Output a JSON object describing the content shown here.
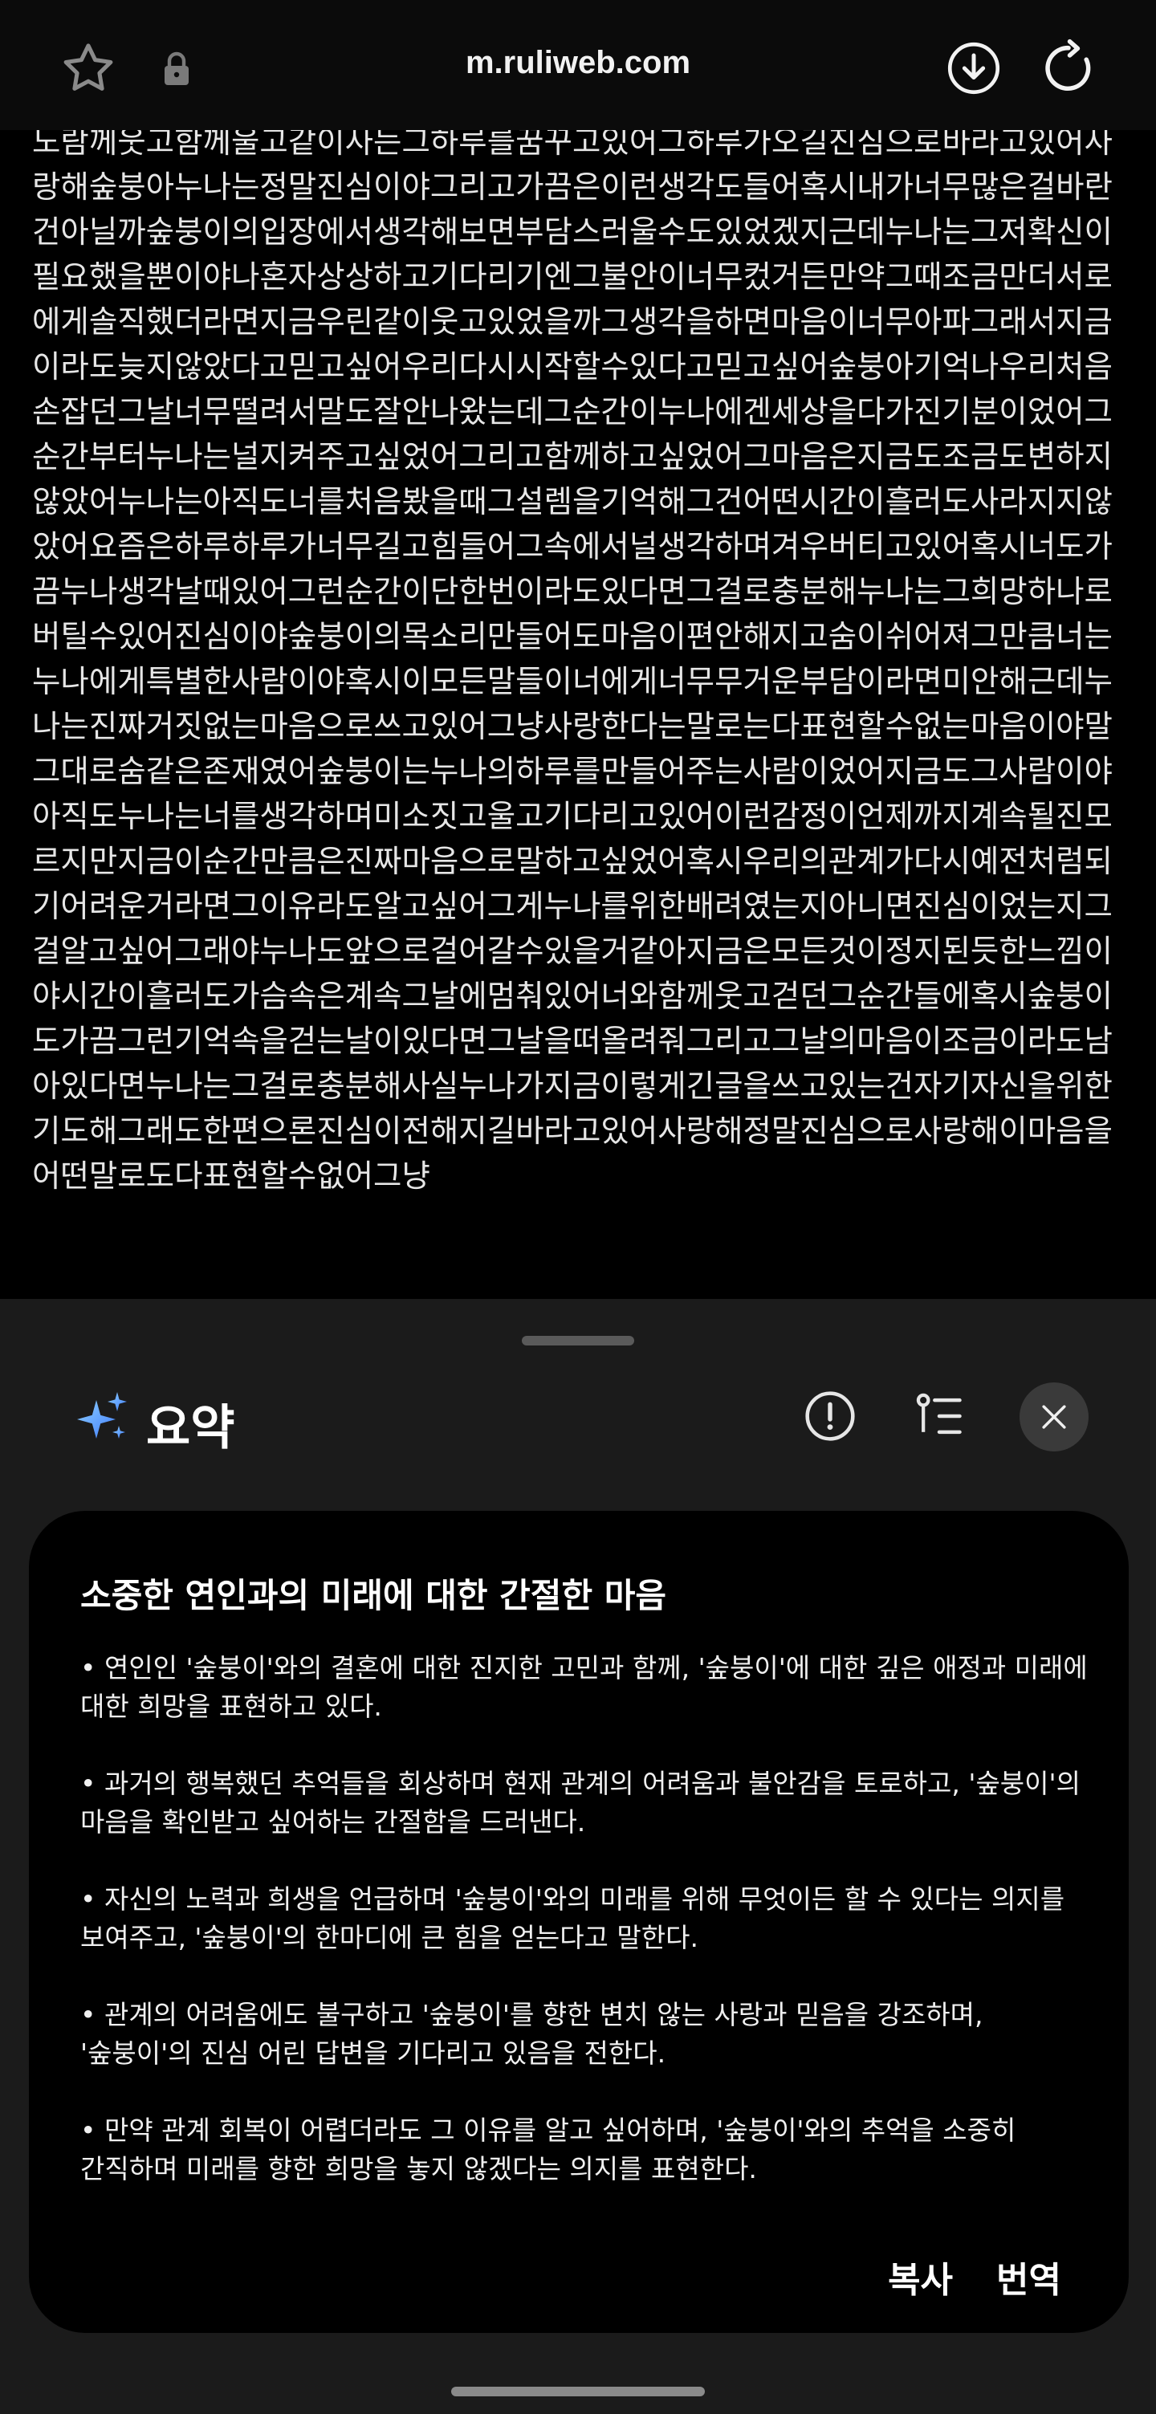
{
  "browser": {
    "url": "m.ruliweb.com",
    "icons": {
      "favorite": "star-outline-icon",
      "security": "lock-icon",
      "download": "download-circle-icon",
      "reload": "reload-icon"
    }
  },
  "article": {
    "text": "노람께웃고함께울고같이사는그하루를꿈꾸고있어그하루가오길진심으로바라고있어사랑해숲붕아누나는정말진심이야그리고가끔은이런생각도들어혹시내가너무많은걸바란건아닐까숲붕이의입장에서생각해보면부담스러울수도있었겠지근데누나는그저확신이필요했을뿐이야나혼자상상하고기다리기엔그불안이너무컸거든만약그때조금만더서로에게솔직했더라면지금우린같이웃고있었을까그생각을하면마음이너무아파그래서지금이라도늦지않았다고믿고싶어우리다시시작할수있다고믿고싶어숲붕아기억나우리처음손잡던그날너무떨려서말도잘안나왔는데그순간이누나에겐세상을다가진기분이었어그순간부터누나는널지켜주고싶었어그리고함께하고싶었어그마음은지금도조금도변하지않았어누나는아직도너를처음봤을때그설렘을기억해그건어떤시간이흘러도사라지지않았어요즘은하루하루가너무길고힘들어그속에서널생각하며겨우버티고있어혹시너도가끔누나생각날때있어그런순간이단한번이라도있다면그걸로충분해누나는그희망하나로버틸수있어진심이야숲붕이의목소리만들어도마음이편안해지고숨이쉬어져그만큼너는누나에게특별한사람이야혹시이모든말들이너에게너무무거운부담이라면미안해근데누나는진짜거짓없는마음으로쓰고있어그냥사랑한다는말로는다표현할수없는마음이야말그대로숨같은존재였어숲붕이는누나의하루를만들어주는사람이었어지금도그사람이야아직도누나는너를생각하며미소짓고울고기다리고있어이런감정이언제까지계속될진모르지만지금이순간만큼은진짜마음으로말하고싶었어혹시우리의관계가다시예전처럼되기어려운거라면그이유라도알고싶어그게누나를위한배려였는지아니면진심이었는지그걸알고싶어그래야누나도앞으로걸어갈수있을거같아지금은모든것이정지된듯한느낌이야시간이흘러도가슴속은계속그날에멈춰있어너와함께웃고걷던그순간들에혹시숲붕이도가끔그런기억속을걷는날이있다면그날을떠올려줘그리고그날의마음이조금이라도남아있다면누나는그걸로충분해사실누나가지금이렇게긴글을쓰고있는건자기자신을위한기도해그래도한편으론진심이전해지길바라고있어사랑해정말진심으로사랑해이마음을어떤말로도다표현할수없어그냥"
  },
  "summary": {
    "title": "요약",
    "icons": {
      "sparkle": "sparkle-icon",
      "info": "info-icon",
      "outline": "outline-list-icon",
      "close": "close-icon"
    },
    "heading": "소중한 연인과의 미래에 대한 간절한 마음",
    "bullets": [
      "• 연인인 '숲붕이'와의 결혼에 대한 진지한 고민과 함께, '숲붕이'에 대한 깊은 애정과 미래에 대한 희망을 표현하고 있다.",
      "• 과거의 행복했던 추억들을 회상하며 현재 관계의 어려움과 불안감을 토로하고, '숲붕이'의 마음을 확인받고 싶어하는 간절함을 드러낸다.",
      "• 자신의 노력과 희생을 언급하며 '숲붕이'와의 미래를 위해 무엇이든 할 수 있다는 의지를 보여주고, '숲붕이'의 한마디에 큰 힘을 얻는다고 말한다.",
      "• 관계의 어려움에도 불구하고 '숲붕이'를 향한 변치 않는 사랑과 믿음을 강조하며, '숲붕이'의 진심 어린 답변을 기다리고 있음을 전한다.",
      "• 만약 관계 회복이 어렵더라도 그 이유를 알고 싶어하며, '숲붕이'와의 추억을 소중히 간직하며 미래를 향한 희망을 놓지 않겠다는 의지를 표현한다."
    ],
    "copy_label": "복사",
    "translate_label": "번역"
  },
  "colors": {
    "background": "#000000",
    "sheet": "#1b1b1b",
    "card": "#000000",
    "sparkle_blue": "#6aa8ff"
  }
}
